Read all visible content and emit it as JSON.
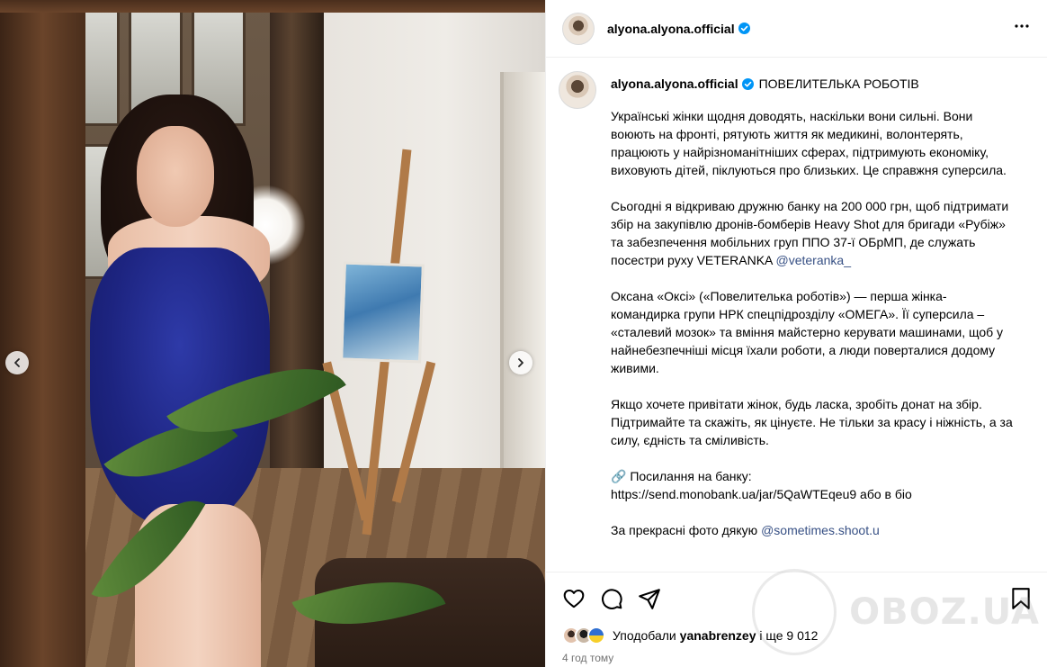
{
  "post": {
    "username": "alyona.alyona.official",
    "verified": true,
    "title": "ПОВЕЛИТЕЛЬКА РОБОТІВ",
    "paragraphs": [
      "Українські жінки щодня доводять, наскільки вони сильні. Вони воюють на фронті, рятують життя як медикині, волонтерять, працюють у найрізноманітніших сферах, підтримують економіку, виховують дітей, піклуються про близьких. Це справжня суперсила.",
      "Сьогодні я відкриваю дружню банку на 200 000 грн, щоб підтримати збір на закупівлю дронів-бомберів Heavy Shot для бригади «Рубіж» та забезпечення мобільних груп ППО 37-ї ОБрМП, де служать посестри руху VETERANKA ",
      "Оксана «Оксі» («Повелителька роботів») — перша жінка-командирка групи НРК спецпідрозділу «ОМЕГА». Її суперсила – «сталевий мозок» та вміння майстерно керувати машинами, щоб у найнебезпечніші місця їхали роботи, а люди поверталися додому живими.",
      "Якщо хочете привітати жінок, будь ласка, зробіть донат на збір. Підтримайте та скажіть, як цінуєте. Не тільки за красу і ніжність, а за силу, єдність та сміливість.",
      "🔗 Посилання на банку:\nhttps://send.monobank.ua/jar/5QaWTEqeu9 або в біо",
      "За прекрасні фото дякую "
    ],
    "mention_veteranka": "@veteranka_",
    "mention_photographer": "@sometimes.shoot.u"
  },
  "likes": {
    "prefix": "Уподобали",
    "user": "yanabrenzey",
    "suffix": "і ще 9 012"
  },
  "time": "4 год тому",
  "watermark": "OBOZ.UA",
  "icons": [
    "chevron-left-icon",
    "chevron-right-icon",
    "more-icon",
    "verified-icon",
    "heart-icon",
    "comment-icon",
    "share-icon",
    "bookmark-icon"
  ],
  "colors": {
    "verified": "#0095f6",
    "mention": "#385185",
    "muted": "#737373"
  }
}
